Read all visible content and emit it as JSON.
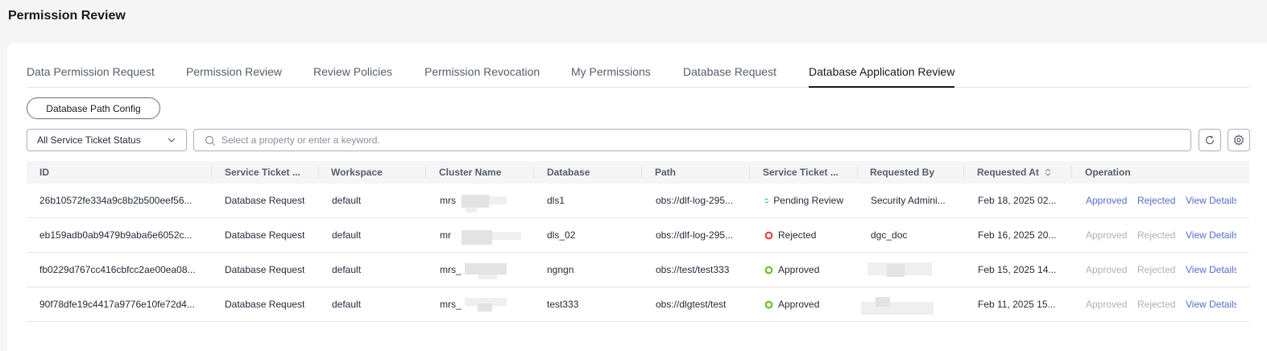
{
  "page": {
    "title": "Permission Review"
  },
  "tabs": [
    {
      "label": "Data Permission Request"
    },
    {
      "label": "Permission Review"
    },
    {
      "label": "Review Policies"
    },
    {
      "label": "Permission Revocation"
    },
    {
      "label": "My Permissions"
    },
    {
      "label": "Database Request"
    },
    {
      "label": "Database Application Review"
    }
  ],
  "toolbar": {
    "config_label": "Database Path Config",
    "status_select": "All Service Ticket Status",
    "search_placeholder": "Select a property or enter a keyword."
  },
  "table": {
    "headers": [
      "ID",
      "Service Ticket ...",
      "Workspace",
      "Cluster Name",
      "Database",
      "Path",
      "Service Ticket ...",
      "Requested By",
      "Requested At",
      "Operation"
    ],
    "rows": [
      {
        "id": "26b10572fe334a9c8b2b500eef56...",
        "type": "Database Request",
        "workspace": "default",
        "cluster": "mrs",
        "database": "dls1",
        "path": "obs://dlf-log-295...",
        "status": "Pending Review",
        "status_kind": "pending",
        "requested_by": "Security Admini...",
        "requested_at": "Feb 18, 2025 02...",
        "ops": [
          "Approved",
          "Rejected",
          "View Details"
        ],
        "ops_enabled": [
          true,
          true,
          true
        ]
      },
      {
        "id": "eb159adb0ab9479b9aba6e6052c...",
        "type": "Database Request",
        "workspace": "default",
        "cluster": "mr",
        "database": "dls_02",
        "path": "obs://dlf-log-295...",
        "status": "Rejected",
        "status_kind": "rejected",
        "requested_by": "dgc_doc",
        "requested_at": "Feb 16, 2025 20...",
        "ops": [
          "Approved",
          "Rejected",
          "View Details"
        ],
        "ops_enabled": [
          false,
          false,
          true
        ]
      },
      {
        "id": "fb0229d767cc416cbfcc2ae00ea08...",
        "type": "Database Request",
        "workspace": "default",
        "cluster": "mrs_",
        "database": "ngngn",
        "path": "obs://test/test333",
        "status": "Approved",
        "status_kind": "approved",
        "requested_by": "",
        "requested_at": "Feb 15, 2025 14...",
        "ops": [
          "Approved",
          "Rejected",
          "View Details"
        ],
        "ops_enabled": [
          false,
          false,
          true
        ]
      },
      {
        "id": "90f78dfe19c4417a9776e10fe72d4...",
        "type": "Database Request",
        "workspace": "default",
        "cluster": "mrs_",
        "database": "test333",
        "path": "obs://dlgtest/test",
        "status": "Approved",
        "status_kind": "approved",
        "requested_by": "",
        "requested_at": "Feb 11, 2025 15...",
        "ops": [
          "Approved",
          "Rejected",
          "View Details"
        ],
        "ops_enabled": [
          false,
          false,
          true
        ]
      }
    ]
  },
  "colors": {
    "link": "#526ecc",
    "disabled": "#adb0b8",
    "pending": "#00a8a8",
    "rejected": "#e54545",
    "approved": "#6dbe2c"
  }
}
